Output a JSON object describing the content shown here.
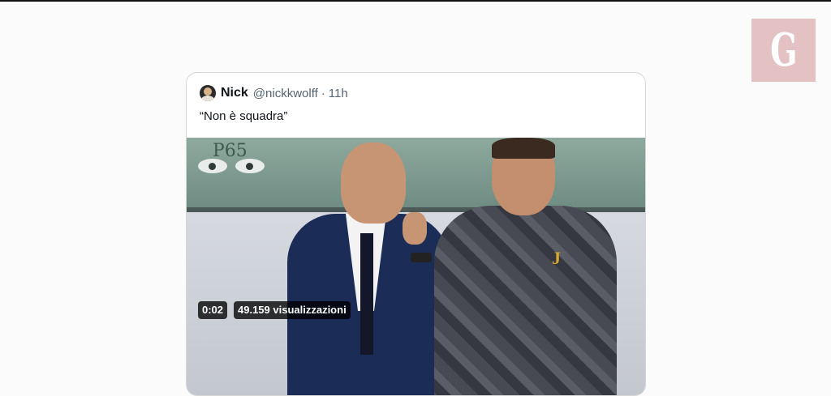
{
  "logo": {
    "letter": "G",
    "color": "#e4c2c4"
  },
  "tweet": {
    "author_name": "Nick",
    "handle": "@nickkwolff",
    "separator": "·",
    "time": "11h",
    "text": "“Non è squadra”"
  },
  "media": {
    "watermark": "P65",
    "crest": "J",
    "duration": "0:02",
    "views": "49.159 visualizzazioni"
  }
}
